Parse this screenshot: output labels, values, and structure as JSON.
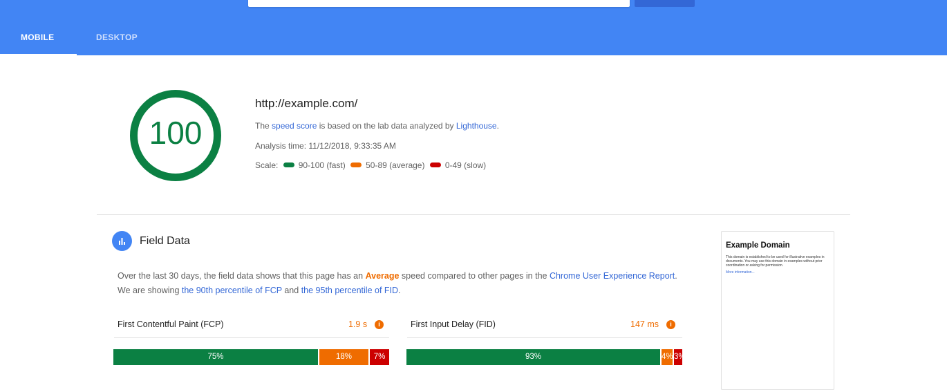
{
  "header": {
    "tabs": [
      {
        "label": "MOBILE",
        "active": true
      },
      {
        "label": "DESKTOP",
        "active": false
      }
    ]
  },
  "score": {
    "value": "100",
    "url": "http://example.com/",
    "desc_pre": "The ",
    "desc_link1": "speed score",
    "desc_mid": " is based on the lab data analyzed by ",
    "desc_link2": "Lighthouse",
    "desc_post": ".",
    "analysis_time": "Analysis time: 11/12/2018, 9:33:35 AM",
    "scale_label": "Scale:",
    "scale_fast": "90-100 (fast)",
    "scale_avg": "50-89 (average)",
    "scale_slow": "0-49 (slow)"
  },
  "field": {
    "icon": "bar-chart-icon",
    "title": "Field Data",
    "desc_p1": "Over the last 30 days, the field data shows that this page has an ",
    "desc_strong": "Average",
    "desc_p2": " speed compared to other pages in the ",
    "desc_link1": "Chrome User Experience Report",
    "desc_p3": ". We are showing ",
    "desc_link2": "the 90th percentile of FCP",
    "desc_p4": " and ",
    "desc_link3": "the 95th percentile of FID",
    "desc_p5": ".",
    "fcp": {
      "label": "First Contentful Paint (FCP)",
      "value": "1.9 s",
      "dist": [
        {
          "label": "75%",
          "share": 75,
          "kind": "fast"
        },
        {
          "label": "18%",
          "share": 18,
          "kind": "avg"
        },
        {
          "label": "7%",
          "share": 7,
          "kind": "slow"
        }
      ]
    },
    "fid": {
      "label": "First Input Delay (FID)",
      "value": "147 ms",
      "dist": [
        {
          "label": "93%",
          "share": 93,
          "kind": "fast"
        },
        {
          "label": "4%",
          "share": 4,
          "kind": "avg"
        },
        {
          "label": "3%",
          "share": 3,
          "kind": "slow"
        }
      ]
    },
    "info_glyph": "i"
  },
  "thumbnail": {
    "title": "Example Domain",
    "body": "This domain is established to be used for illustrative examples in documents. You may use this domain in examples without prior coordination or asking for permission.",
    "link": "More information..."
  },
  "colors": {
    "brand": "#4285f4",
    "fast": "#0b8043",
    "average": "#ef6c00",
    "slow": "#cc0000"
  }
}
